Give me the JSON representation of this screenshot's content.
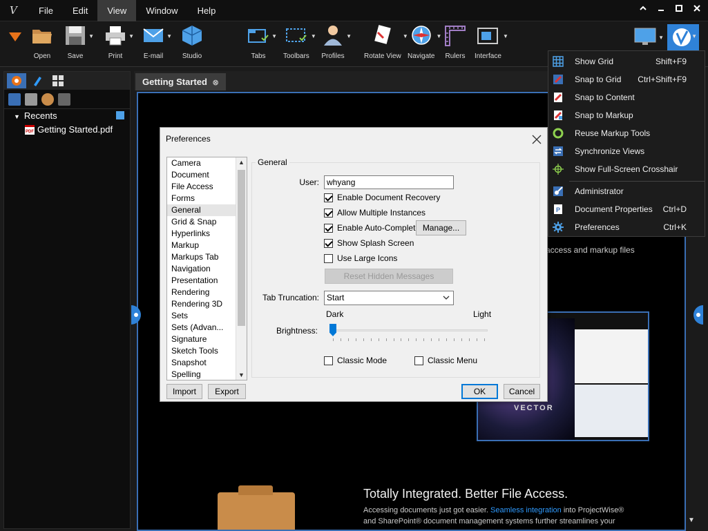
{
  "app": {
    "logo": "V",
    "menus": [
      "File",
      "Edit",
      "View",
      "Window",
      "Help"
    ],
    "active_menu": "View"
  },
  "window_controls": {
    "help": "?",
    "minimize": "▃",
    "maximize": "□",
    "close": "✕"
  },
  "toolbar": {
    "open": "Open",
    "save": "Save",
    "print": "Print",
    "email": "E-mail",
    "studio": "Studio",
    "tabs": "Tabs",
    "toolbars": "Toolbars",
    "profiles": "Profiles",
    "rotate_view": "Rotate View",
    "navigate": "Navigate",
    "rulers": "Rulers",
    "interface": "Interface"
  },
  "left_panel": {
    "recents_label": "Recents",
    "recent_file": "Getting Started.pdf",
    "pdf_badge": "PDF"
  },
  "doc_tab": {
    "title": "Getting Started",
    "close": "⊗"
  },
  "promo": {
    "top_text": "access and markup files",
    "title": "Totally Integrated. Better File Access.",
    "line1_prefix": "Accessing documents just got easier. ",
    "line1_highlight": "Seamless integration",
    "line1_suffix": " into ProjectWise®",
    "line2": "and SharePoint® document management systems further streamlines your",
    "vector": "VECTOR"
  },
  "preferences": {
    "title": "Preferences",
    "categories": [
      "Camera",
      "Document",
      "File Access",
      "Forms",
      "General",
      "Grid & Snap",
      "Hyperlinks",
      "Markup",
      "Markups Tab",
      "Navigation",
      "Presentation",
      "Rendering",
      "Rendering 3D",
      "Sets",
      "Sets (Advan...",
      "Signature",
      "Sketch Tools",
      "Snapshot",
      "Spelling"
    ],
    "selected_category": "General",
    "group_label": "General",
    "user_label": "User:",
    "user_value": "whyang",
    "checkboxes": [
      {
        "label": "Enable Document Recovery",
        "checked": true
      },
      {
        "label": "Allow Multiple Instances",
        "checked": true
      },
      {
        "label": "Enable Auto-Complete",
        "checked": true
      },
      {
        "label": "Show Splash Screen",
        "checked": true
      },
      {
        "label": "Use Large Icons",
        "checked": false
      }
    ],
    "manage_button": "Manage...",
    "reset_button": "Reset Hidden Messages",
    "tab_truncation_label": "Tab Truncation:",
    "tab_truncation_value": "Start",
    "brightness_label": "Brightness:",
    "brightness_dark": "Dark",
    "brightness_light": "Light",
    "brightness_level": 0,
    "classic_mode": {
      "label": "Classic Mode",
      "checked": false
    },
    "classic_menu": {
      "label": "Classic Menu",
      "checked": false
    },
    "import_button": "Import",
    "export_button": "Export",
    "ok_button": "OK",
    "cancel_button": "Cancel"
  },
  "view_menu": {
    "items": [
      {
        "label": "Show Grid",
        "shortcut": "Shift+F9",
        "icon": "grid-icon"
      },
      {
        "label": "Snap to Grid",
        "shortcut": "Ctrl+Shift+F9",
        "icon": "snap-grid-icon"
      },
      {
        "label": "Snap to Content",
        "shortcut": "",
        "icon": "snap-content-icon"
      },
      {
        "label": "Snap to Markup",
        "shortcut": "",
        "icon": "snap-markup-icon"
      },
      {
        "label": "Reuse Markup Tools",
        "shortcut": "",
        "icon": "reuse-icon"
      },
      {
        "label": "Synchronize Views",
        "shortcut": "",
        "icon": "sync-icon"
      },
      {
        "label": "Show Full-Screen Crosshair",
        "shortcut": "",
        "icon": "crosshair-icon"
      },
      {
        "label": "Administrator",
        "shortcut": "",
        "icon": "admin-icon"
      },
      {
        "label": "Document Properties",
        "shortcut": "Ctrl+D",
        "icon": "doc-properties-icon"
      },
      {
        "label": "Preferences",
        "shortcut": "Ctrl+K",
        "icon": "gear-icon"
      }
    ]
  },
  "colors": {
    "accent": "#2f82d8",
    "selection": "#3a6fb5",
    "background": "#1b1b1b"
  }
}
